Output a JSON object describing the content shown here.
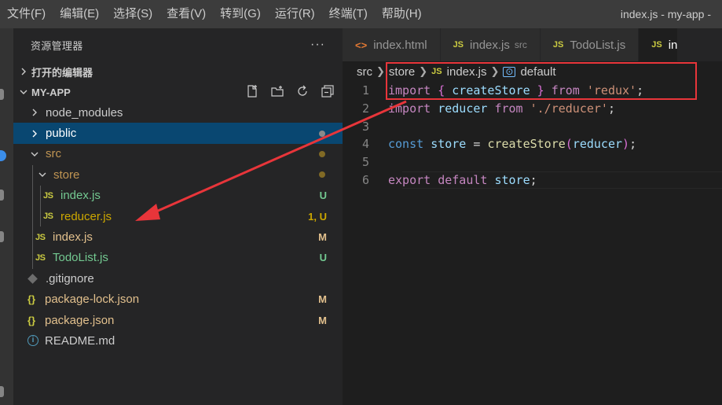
{
  "menu": {
    "items": [
      "文件(F)",
      "编辑(E)",
      "选择(S)",
      "查看(V)",
      "转到(G)",
      "运行(R)",
      "终端(T)",
      "帮助(H)"
    ],
    "window_title": "index.js - my-app -"
  },
  "sidebar": {
    "title": "资源管理器",
    "more": "···",
    "open_editors": "打开的编辑器",
    "project": "MY-APP",
    "tree": [
      {
        "name": "node_modules",
        "type": "folder",
        "expanded": false,
        "color": "#cccccc"
      },
      {
        "name": "public",
        "type": "folder",
        "expanded": false,
        "color": "#ffffff",
        "selected": true
      },
      {
        "name": "src",
        "type": "folder",
        "expanded": true,
        "color": "#c09553"
      },
      {
        "name": "store",
        "type": "folder",
        "expanded": true,
        "color": "#c09553"
      },
      {
        "name": "index.js",
        "type": "js",
        "color": "#73c991",
        "badge": "U"
      },
      {
        "name": "reducer.js",
        "type": "js",
        "color": "#cca700",
        "badge": "1, U"
      },
      {
        "name": "index.js",
        "type": "js",
        "color": "#e2c08d",
        "badge": "M"
      },
      {
        "name": "TodoList.js",
        "type": "js",
        "color": "#73c991",
        "badge": "U"
      },
      {
        "name": ".gitignore",
        "type": "git",
        "color": "#cccccc"
      },
      {
        "name": "package-lock.json",
        "type": "json",
        "color": "#e2c08d",
        "badge": "M"
      },
      {
        "name": "package.json",
        "type": "json",
        "color": "#e2c08d",
        "badge": "M"
      },
      {
        "name": "README.md",
        "type": "info",
        "color": "#cccccc"
      }
    ]
  },
  "tabs": [
    {
      "label": "index.html",
      "icon": "<>",
      "desc": ""
    },
    {
      "label": "index.js",
      "icon": "JS",
      "desc": "src"
    },
    {
      "label": "TodoList.js",
      "icon": "JS",
      "desc": ""
    },
    {
      "label": "in",
      "icon": "JS",
      "desc": ""
    }
  ],
  "breadcrumbs": {
    "src": "src",
    "store": "store",
    "js_icon": "JS",
    "file": "index.js",
    "symbol": "default"
  },
  "code": {
    "line_numbers": [
      "1",
      "2",
      "3",
      "4",
      "5",
      "6"
    ],
    "l1": {
      "import": "import",
      "open": "{",
      "name": "createStore",
      "close": "}",
      "from": "from",
      "module": "'redux'",
      "semi": ";"
    },
    "l2": {
      "import": "import",
      "name": "reducer",
      "from": "from",
      "module": "'./reducer'",
      "semi": ";"
    },
    "l4": {
      "const": "const",
      "name": "store",
      "eq": "=",
      "fn": "createStore",
      "open": "(",
      "arg": "reducer",
      "close": ")",
      "semi": ";"
    },
    "l6": {
      "export": "export",
      "default": "default",
      "name": "store",
      "semi": ";"
    }
  },
  "colors": {
    "annotation_red": "#e8353a",
    "selection_blue": "#094771"
  }
}
